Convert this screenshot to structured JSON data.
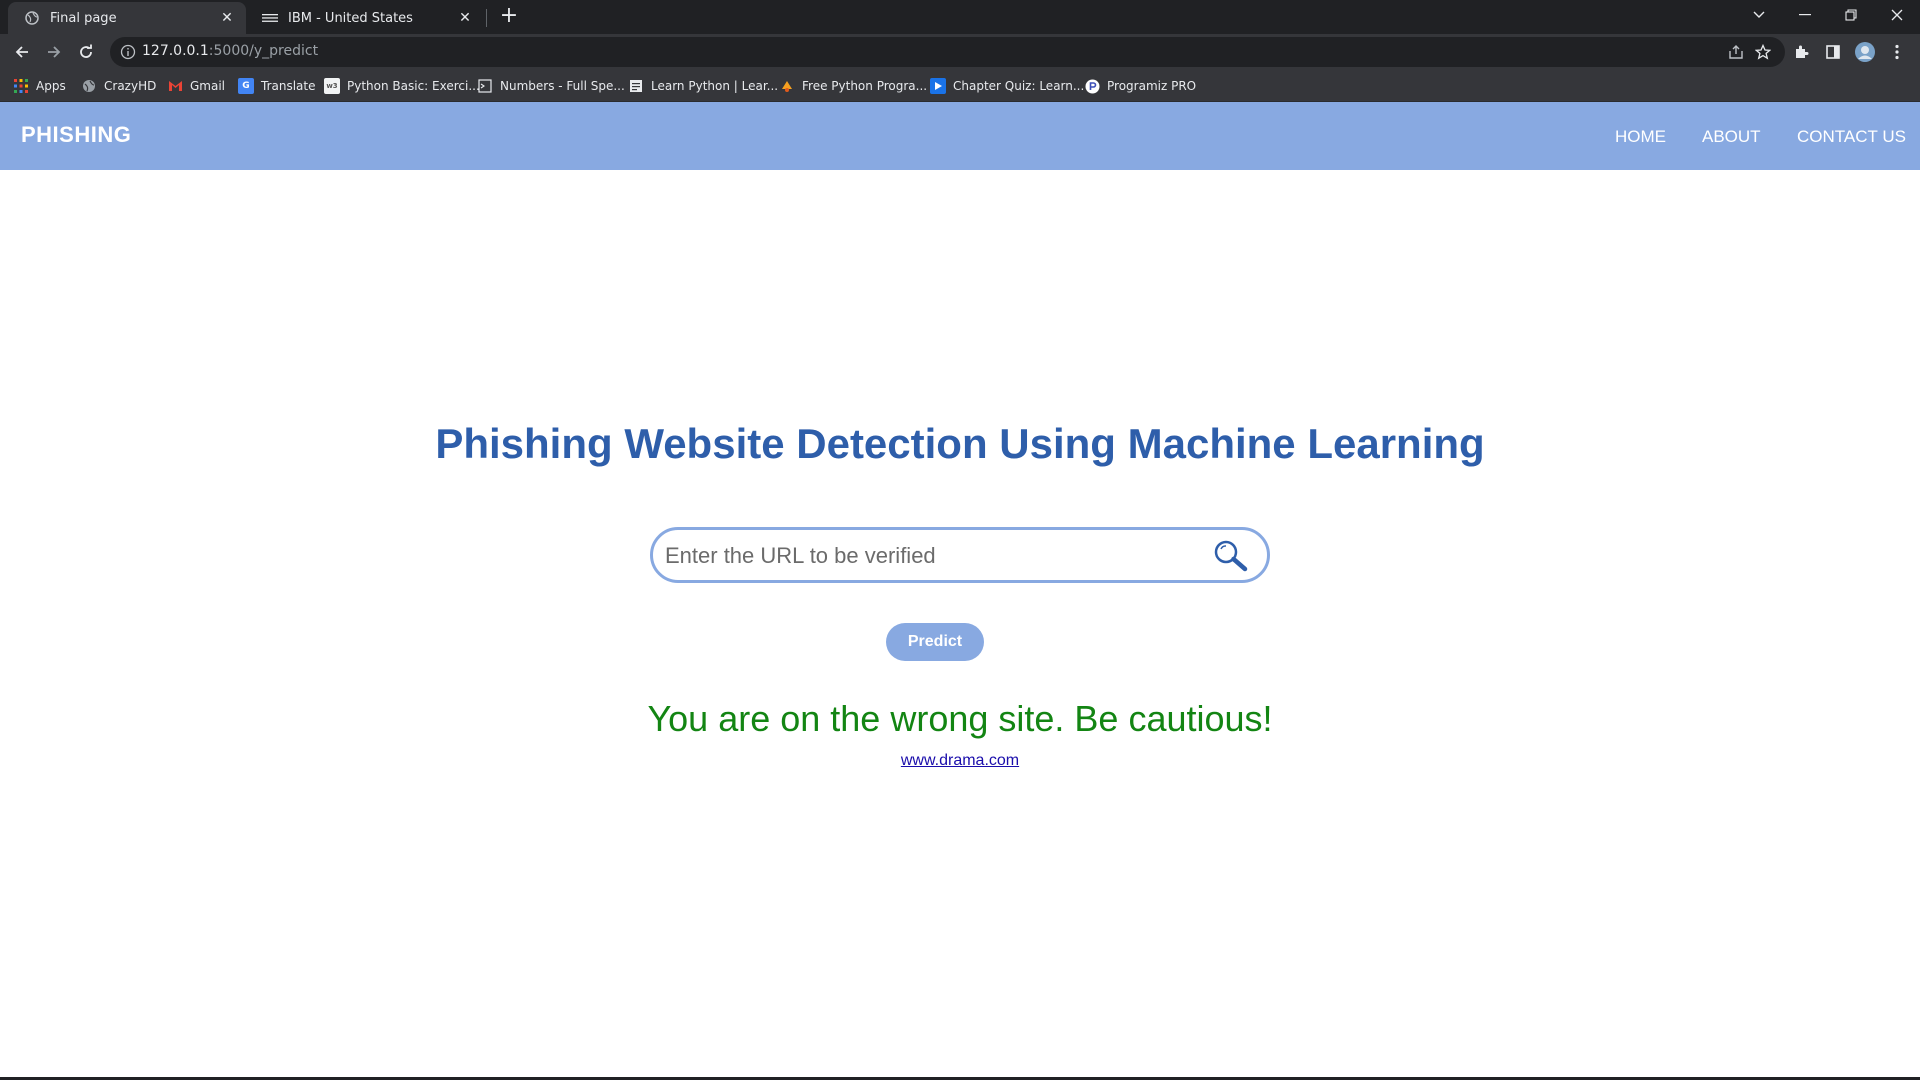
{
  "browser": {
    "tabs": [
      {
        "title": "Final page",
        "active": true
      },
      {
        "title": "IBM - United States",
        "active": false
      }
    ],
    "url": {
      "host": "127.0.0.1",
      "rest": ":5000/y_predict"
    },
    "bookmarks": [
      {
        "label": "Apps",
        "icon": "apps-grid-icon"
      },
      {
        "label": "CrazyHD",
        "icon": "globe-icon"
      },
      {
        "label": "Gmail",
        "icon": "gmail-icon"
      },
      {
        "label": "Translate",
        "icon": "translate-icon"
      },
      {
        "label": "Python Basic: Exerci...",
        "icon": "w3resource-icon"
      },
      {
        "label": "Numbers - Full Spe...",
        "icon": "page-icon"
      },
      {
        "label": "Learn Python | Lear...",
        "icon": "page-icon"
      },
      {
        "label": "Free Python Progra...",
        "icon": "python-icon"
      },
      {
        "label": "Chapter Quiz: Learn...",
        "icon": "play-icon"
      },
      {
        "label": "Programiz PRO",
        "icon": "programiz-icon"
      }
    ]
  },
  "site": {
    "brand": "PHISHING",
    "nav": {
      "home": "HOME",
      "about": "ABOUT",
      "contact": "CONTACT US"
    },
    "heading": "Phishing Website Detection Using Machine Learning",
    "search": {
      "placeholder": "Enter the URL to be verified",
      "value": ""
    },
    "predict_label": "Predict",
    "result_message": "You are on the wrong site. Be cautious!",
    "checked_url": "www.drama.com"
  },
  "colors": {
    "navbar": "#88a9e1",
    "heading": "#2e5eaa",
    "result": "#138513",
    "link": "#1a0dab"
  }
}
